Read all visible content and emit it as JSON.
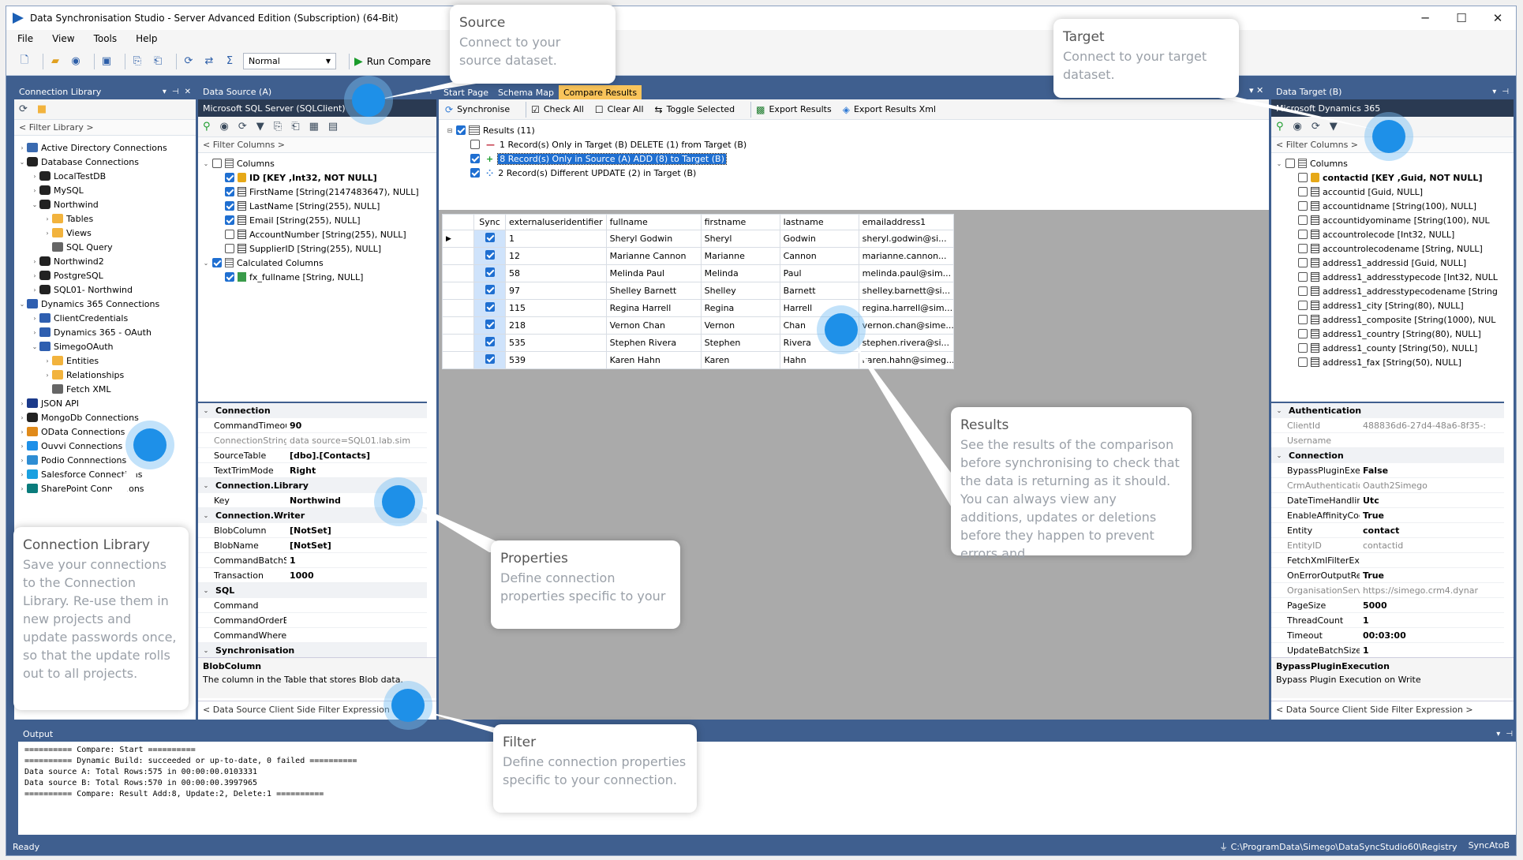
{
  "window": {
    "title": "Data Synchronisation Studio - Server Advanced Edition (Subscription) (64-Bit)",
    "min": "─",
    "max": "☐",
    "close": "✕"
  },
  "menu": [
    "File",
    "View",
    "Tools",
    "Help"
  ],
  "toolbar": {
    "mode": "Normal",
    "run": "Run Compare"
  },
  "connection_library": {
    "title": "Connection Library",
    "filter": "< Filter Library >",
    "items": [
      {
        "label": "Active Directory Connections",
        "indent": 0,
        "exp": "›",
        "icon": "ad"
      },
      {
        "label": "Database Connections",
        "indent": 0,
        "exp": "⌄",
        "icon": "db"
      },
      {
        "label": "LocalTestDB",
        "indent": 1,
        "exp": "›",
        "icon": "db"
      },
      {
        "label": "MySQL",
        "indent": 1,
        "exp": "›",
        "icon": "db"
      },
      {
        "label": "Northwind",
        "indent": 1,
        "exp": "⌄",
        "icon": "db"
      },
      {
        "label": "Tables",
        "indent": 2,
        "exp": "›",
        "icon": "fold"
      },
      {
        "label": "Views",
        "indent": 2,
        "exp": "›",
        "icon": "fold"
      },
      {
        "label": "SQL Query",
        "indent": 2,
        "exp": "",
        "icon": "grid"
      },
      {
        "label": "Northwind2",
        "indent": 1,
        "exp": "›",
        "icon": "db"
      },
      {
        "label": "PostgreSQL",
        "indent": 1,
        "exp": "›",
        "icon": "db"
      },
      {
        "label": "SQL01- Northwind",
        "indent": 1,
        "exp": "›",
        "icon": "db"
      },
      {
        "label": "Dynamics 365 Connections",
        "indent": 0,
        "exp": "⌄",
        "icon": "dyn"
      },
      {
        "label": "ClientCredentials",
        "indent": 1,
        "exp": "›",
        "icon": "dyn"
      },
      {
        "label": "Dynamics 365 - OAuth",
        "indent": 1,
        "exp": "›",
        "icon": "dyn"
      },
      {
        "label": "SimegoOAuth",
        "indent": 1,
        "exp": "⌄",
        "icon": "dyn"
      },
      {
        "label": "Entities",
        "indent": 2,
        "exp": "›",
        "icon": "fold"
      },
      {
        "label": "Relationships",
        "indent": 2,
        "exp": "›",
        "icon": "fold"
      },
      {
        "label": "Fetch XML",
        "indent": 2,
        "exp": "",
        "icon": "grid"
      },
      {
        "label": "JSON API",
        "indent": 0,
        "exp": "›",
        "icon": "json"
      },
      {
        "label": "MongoDb Connections",
        "indent": 0,
        "exp": "›",
        "icon": "db"
      },
      {
        "label": "OData Connections",
        "indent": 0,
        "exp": "›",
        "icon": "odata"
      },
      {
        "label": "Ouvvi Connections",
        "indent": 0,
        "exp": "›",
        "icon": "ouvvi"
      },
      {
        "label": "Podio Connnections",
        "indent": 0,
        "exp": "›",
        "icon": "podio"
      },
      {
        "label": "Salesforce Connections",
        "indent": 0,
        "exp": "›",
        "icon": "sf"
      },
      {
        "label": "SharePoint Connections",
        "indent": 0,
        "exp": "›",
        "icon": "sp"
      }
    ]
  },
  "data_source": {
    "title": "Data Source (A)",
    "provider": "Microsoft SQL Server (SQLClient)",
    "filter": "< Filter Columns >",
    "columns": [
      {
        "label": "Columns",
        "level": 0,
        "exp": "⌄",
        "checked": false,
        "icon": "grid"
      },
      {
        "label": "ID [KEY ,Int32, NOT NULL]",
        "level": 1,
        "checked": true,
        "bold": true,
        "icon": "key"
      },
      {
        "label": "FirstName [String(2147483647), NULL]",
        "level": 1,
        "checked": true,
        "icon": "col"
      },
      {
        "label": "LastName [String(255), NULL]",
        "level": 1,
        "checked": true,
        "icon": "col"
      },
      {
        "label": "Email [String(255), NULL]",
        "level": 1,
        "checked": true,
        "icon": "col"
      },
      {
        "label": "AccountNumber [String(255), NULL]",
        "level": 1,
        "checked": false,
        "icon": "col"
      },
      {
        "label": "SupplierID [String(255), NULL]",
        "level": 1,
        "checked": false,
        "icon": "col"
      },
      {
        "label": "Calculated Columns",
        "level": 0,
        "exp": "⌄",
        "checked": true,
        "icon": "grid"
      },
      {
        "label": "fx_fullname [String, NULL]",
        "level": 1,
        "checked": true,
        "icon": "fx"
      }
    ],
    "props": [
      {
        "cat": "Connection"
      },
      {
        "k": "CommandTimeout",
        "v": "90"
      },
      {
        "k": "ConnectionString",
        "v": "data source=SQL01.lab.sim",
        "gray": true
      },
      {
        "k": "SourceTable",
        "v": "[dbo].[Contacts]"
      },
      {
        "k": "TextTrimMode",
        "v": "Right"
      },
      {
        "cat": "Connection.Library"
      },
      {
        "k": "Key",
        "v": "Northwind"
      },
      {
        "cat": "Connection.Writer"
      },
      {
        "k": "BlobColumn",
        "v": "[NotSet]"
      },
      {
        "k": "BlobName",
        "v": "[NotSet]"
      },
      {
        "k": "CommandBatchSize",
        "v": "1"
      },
      {
        "k": "Transaction",
        "v": "1000"
      },
      {
        "cat": "SQL"
      },
      {
        "k": "Command",
        "v": ""
      },
      {
        "k": "CommandOrderBy",
        "v": ""
      },
      {
        "k": "CommandWhere",
        "v": ""
      },
      {
        "cat": "Synchronisation"
      }
    ],
    "desc_title": "BlobColumn",
    "desc_text": "The column in the Table that stores Blob data.",
    "footer": "< Data Source Client Side Filter Expression >"
  },
  "center": {
    "tabs": [
      "Start Page",
      "Schema Map",
      "Compare Results"
    ],
    "toolbar": [
      "Synchronise",
      "Check All",
      "Clear All",
      "Toggle Selected",
      "Export Results",
      "Export Results Xml"
    ],
    "results_root": "Results (11)",
    "results": [
      {
        "label": "1 Record(s) Only in Target (B) DELETE (1) from Target (B)",
        "mark": "—",
        "color": "#c0283a",
        "checked": false
      },
      {
        "label": "8 Record(s) Only in Source (A) ADD (8) to Target (B)",
        "mark": "+",
        "color": "#1a9b2a",
        "checked": true,
        "sel": true
      },
      {
        "label": "2 Record(s) Different UPDATE (2) in Target (B)",
        "mark": "⁘",
        "color": "#2c78d4",
        "checked": true
      }
    ],
    "grid_headers": [
      "Sync",
      "externaluseridentifier",
      "fullname",
      "firstname",
      "lastname",
      "emailaddress1"
    ],
    "grid_rows": [
      [
        "1",
        "Sheryl Godwin",
        "Sheryl",
        "Godwin",
        "sheryl.godwin@si..."
      ],
      [
        "12",
        "Marianne Cannon",
        "Marianne",
        "Cannon",
        "marianne.cannon..."
      ],
      [
        "58",
        "Melinda Paul",
        "Melinda",
        "Paul",
        "melinda.paul@sim..."
      ],
      [
        "97",
        "Shelley Barnett",
        "Shelley",
        "Barnett",
        "shelley.barnett@si..."
      ],
      [
        "115",
        "Regina Harrell",
        "Regina",
        "Harrell",
        "regina.harrell@sim..."
      ],
      [
        "218",
        "Vernon Chan",
        "Vernon",
        "Chan",
        "vernon.chan@sime..."
      ],
      [
        "535",
        "Stephen Rivera",
        "Stephen",
        "Rivera",
        "stephen.rivera@si..."
      ],
      [
        "539",
        "Karen Hahn",
        "Karen",
        "Hahn",
        "karen.hahn@simeg..."
      ]
    ]
  },
  "data_target": {
    "title": "Data Target (B)",
    "provider": "Microsoft Dynamics 365",
    "filter": "< Filter Columns >",
    "columns": [
      {
        "label": "Columns",
        "level": 0,
        "exp": "⌄",
        "checked": false,
        "icon": "grid"
      },
      {
        "label": "contactid [KEY ,Guid, NOT NULL]",
        "level": 1,
        "checked": false,
        "bold": true,
        "icon": "key"
      },
      {
        "label": "accountid [Guid, NULL]",
        "level": 1,
        "checked": false,
        "icon": "col"
      },
      {
        "label": "accountidname [String(100), NULL]",
        "level": 1,
        "checked": false,
        "icon": "col"
      },
      {
        "label": "accountidyominame [String(100), NUL",
        "level": 1,
        "checked": false,
        "icon": "col"
      },
      {
        "label": "accountrolecode [Int32, NULL]",
        "level": 1,
        "checked": false,
        "icon": "col"
      },
      {
        "label": "accountrolecodename [String, NULL]",
        "level": 1,
        "checked": false,
        "icon": "col"
      },
      {
        "label": "address1_addressid [Guid, NULL]",
        "level": 1,
        "checked": false,
        "icon": "col"
      },
      {
        "label": "address1_addresstypecode [Int32, NULL",
        "level": 1,
        "checked": false,
        "icon": "col"
      },
      {
        "label": "address1_addresstypecodename [String",
        "level": 1,
        "checked": false,
        "icon": "col"
      },
      {
        "label": "address1_city [String(80), NULL]",
        "level": 1,
        "checked": false,
        "icon": "col"
      },
      {
        "label": "address1_composite [String(1000), NUL",
        "level": 1,
        "checked": false,
        "icon": "col"
      },
      {
        "label": "address1_country [String(80), NULL]",
        "level": 1,
        "checked": false,
        "icon": "col"
      },
      {
        "label": "address1_county [String(50), NULL]",
        "level": 1,
        "checked": false,
        "icon": "col"
      },
      {
        "label": "address1_fax [String(50), NULL]",
        "level": 1,
        "checked": false,
        "icon": "col"
      }
    ],
    "props": [
      {
        "cat": "Authentication"
      },
      {
        "k": "ClientId",
        "v": "488836d6-27d4-48a6-8f35-:",
        "gray": true
      },
      {
        "k": "Username",
        "v": "",
        "gray": true
      },
      {
        "cat": "Connection"
      },
      {
        "k": "BypassPluginExecutic",
        "v": "False"
      },
      {
        "k": "CrmAuthenticationPr",
        "v": "Oauth2Simego",
        "gray": true
      },
      {
        "k": "DateTimeHandling",
        "v": "Utc"
      },
      {
        "k": "EnableAffinityCookie",
        "v": "True"
      },
      {
        "k": "Entity",
        "v": "contact"
      },
      {
        "k": "EntityID",
        "v": "contactid",
        "gray": true
      },
      {
        "k": "FetchXmlFilterExpress",
        "v": ""
      },
      {
        "k": "OnErrorOutputReque",
        "v": "True"
      },
      {
        "k": "OrganisationServiceU",
        "v": "https://simego.crm4.dynar",
        "gray": true
      },
      {
        "k": "PageSize",
        "v": "5000"
      },
      {
        "k": "ThreadCount",
        "v": "1"
      },
      {
        "k": "Timeout",
        "v": "00:03:00"
      },
      {
        "k": "UpdateBatchSize",
        "v": "1"
      }
    ],
    "desc_title": "BypassPluginExecution",
    "desc_text": "Bypass Plugin Execution on Write",
    "footer": "< Data Source Client Side Filter Expression >"
  },
  "output": {
    "title": "Output",
    "lines": "========== Compare: Start ==========\n========== Dynamic Build: succeeded or up-to-date, 0 failed ==========\nData source A: Total Rows:575 in 00:00:00.0103331\nData source B: Total Rows:570 in 00:00:00.3997965\n========== Compare: Result Add:8, Update:2, Delete:1 =========="
  },
  "status": {
    "left": "Ready",
    "path": "C:\\ProgramData\\Simego\\DataSyncStudio60\\Registry",
    "mode": "SyncAtoB"
  },
  "callouts": {
    "source": {
      "h": "Source",
      "b": "Connect to your source dataset."
    },
    "target": {
      "h": "Target",
      "b": "Connect to your target dataset."
    },
    "results": {
      "h": "Results",
      "b": "See the results of the comparison before synchronising to check that the data is returning as it should. You can always view any additions, updates or deletions before they happen to prevent errors and"
    },
    "properties": {
      "h": "Properties",
      "b": "Define connection properties specific to your"
    },
    "library": {
      "h": "Connection Library",
      "b": "Save your connections to the Connection Library. Re-use them in new projects and update passwords once, so that the update rolls out to all projects."
    },
    "filter": {
      "h": "Filter",
      "b": "Define connection properties specific to your connection."
    }
  }
}
